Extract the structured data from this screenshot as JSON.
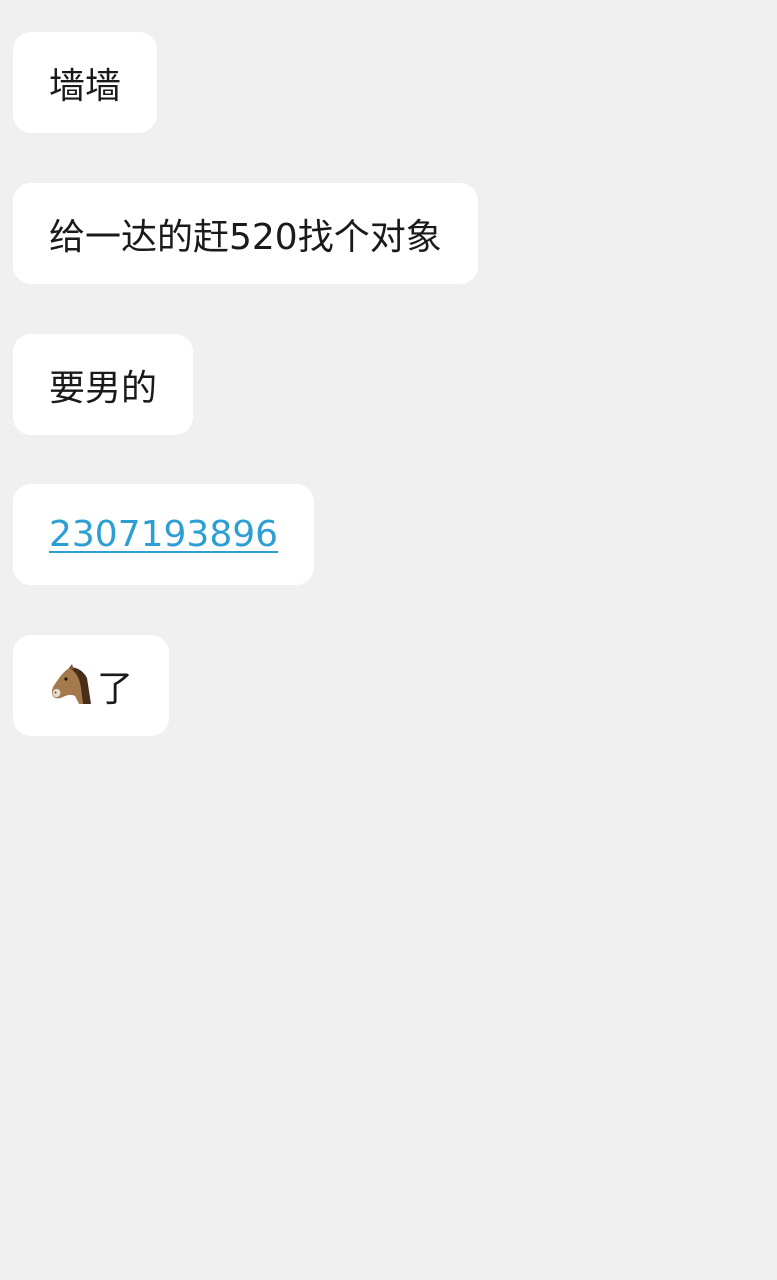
{
  "messages": [
    {
      "text": "墙墙"
    },
    {
      "text": "给一达的赶520找个对象"
    },
    {
      "text": "要男的"
    },
    {
      "text": "2307193896"
    },
    {
      "icon": "horse-face-icon",
      "text": "了"
    }
  ],
  "colors": {
    "background": "#f0f0f0",
    "bubble": "#ffffff",
    "link": "#2b9fd4"
  }
}
